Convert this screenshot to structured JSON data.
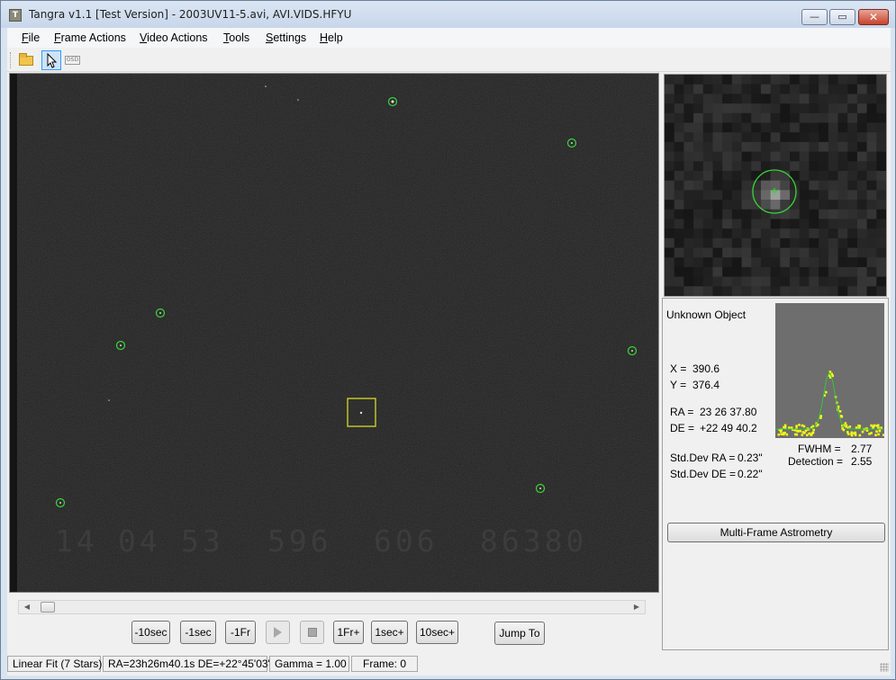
{
  "window": {
    "title": "Tangra v1.1 [Test Version] - 2003UV11-5.avi, AVI.VIDS.HFYU",
    "icon": "tangra-app-icon",
    "controls": {
      "minimize": "—",
      "maximize": "▭",
      "close": "✕"
    }
  },
  "menu": {
    "items": [
      "File",
      "Frame Actions",
      "Video Actions",
      "Tools",
      "Settings",
      "Help"
    ]
  },
  "toolbar": {
    "open_icon": "folder-open-icon",
    "pointer_icon": "pointer-icon",
    "osd_icon": "osd-icon",
    "osd_label": "OSD"
  },
  "video": {
    "timestamp": [
      "14",
      "04",
      "53",
      "596",
      "606",
      "86380"
    ],
    "star_color": "#37d737",
    "target_color": "#e6e62a"
  },
  "navigation": {
    "buttons": [
      "-10sec",
      "-1sec",
      "-1Fr",
      "",
      "",
      "1Fr+",
      "1sec+",
      "10sec+"
    ],
    "jump_label": "Jump To"
  },
  "object_info": {
    "name": "Unknown Object",
    "x_label": "X =",
    "x_value": "390.6",
    "y_label": "Y =",
    "y_value": "376.4",
    "ra_label": "RA =",
    "ra_value": "23 26 37.80",
    "de_label": "DE =",
    "de_value": "+22 49 40.2",
    "stddev_ra_label": "Std.Dev RA =",
    "stddev_ra_value": "0.23\"",
    "stddev_de_label": "Std.Dev DE =",
    "stddev_de_value": "0.22\"",
    "fwhm_label": "FWHM =",
    "fwhm_value": "2.77",
    "detection_label": "Detection =",
    "detection_value": "2.55",
    "multi_frame_button": "Multi-Frame Astrometry"
  },
  "status": {
    "fit": "Linear Fit (7 Stars)",
    "coords": "RA=23h26m40.1s DE=+22°45'03\"",
    "gamma": "Gamma = 1.00",
    "frame": "Frame: 0"
  }
}
